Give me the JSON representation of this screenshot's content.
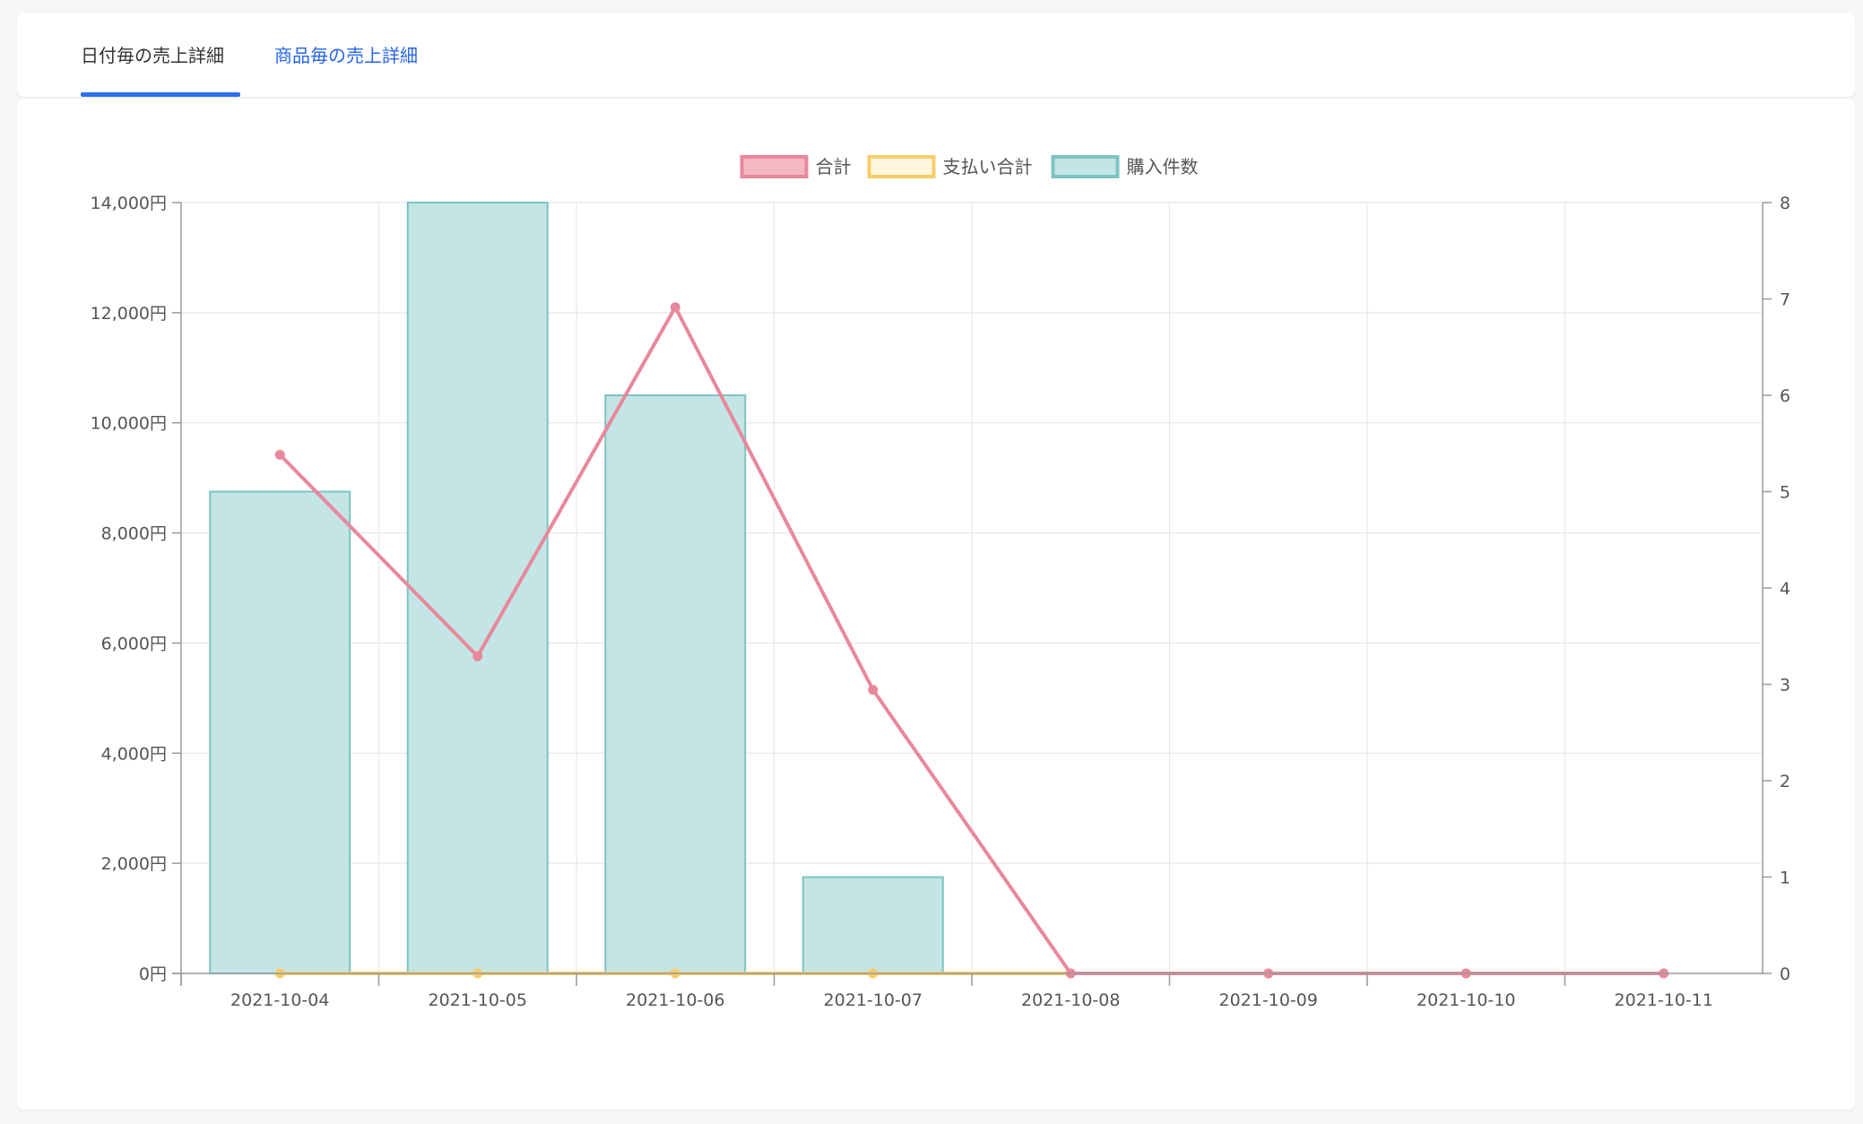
{
  "tabs": [
    {
      "label": "日付毎の売上詳細",
      "active": true
    },
    {
      "label": "商品毎の売上詳細",
      "active": false
    }
  ],
  "chart_data": {
    "type": "bar",
    "categories": [
      "2021-10-04",
      "2021-10-05",
      "2021-10-06",
      "2021-10-07",
      "2021-10-08",
      "2021-10-09",
      "2021-10-10",
      "2021-10-11"
    ],
    "series": [
      {
        "name": "合計",
        "type": "line",
        "axis": "left",
        "color": "#e8889c",
        "values": [
          9420,
          5760,
          12100,
          5150,
          0,
          0,
          0,
          0
        ]
      },
      {
        "name": "支払い合計",
        "type": "line",
        "axis": "left",
        "color": "#f7cd6a",
        "values": [
          0,
          0,
          0,
          0,
          0,
          0,
          0,
          0
        ]
      },
      {
        "name": "購入件数",
        "type": "bar",
        "axis": "right",
        "color": "#c4e5e5",
        "border": "#7dc4c4",
        "values": [
          5,
          8,
          6,
          1,
          0,
          0,
          0,
          0
        ]
      }
    ],
    "y_left": {
      "min": 0,
      "max": 14000,
      "step": 2000,
      "suffix": "円",
      "tick_labels": [
        "0円",
        "2,000円",
        "4,000円",
        "6,000円",
        "8,000円",
        "10,000円",
        "12,000円",
        "14,000円"
      ]
    },
    "y_right": {
      "min": 0,
      "max": 8,
      "step": 1,
      "tick_labels": [
        "0",
        "1",
        "2",
        "3",
        "4",
        "5",
        "6",
        "7",
        "8"
      ]
    },
    "grid": true,
    "legend_position": "top-center"
  }
}
